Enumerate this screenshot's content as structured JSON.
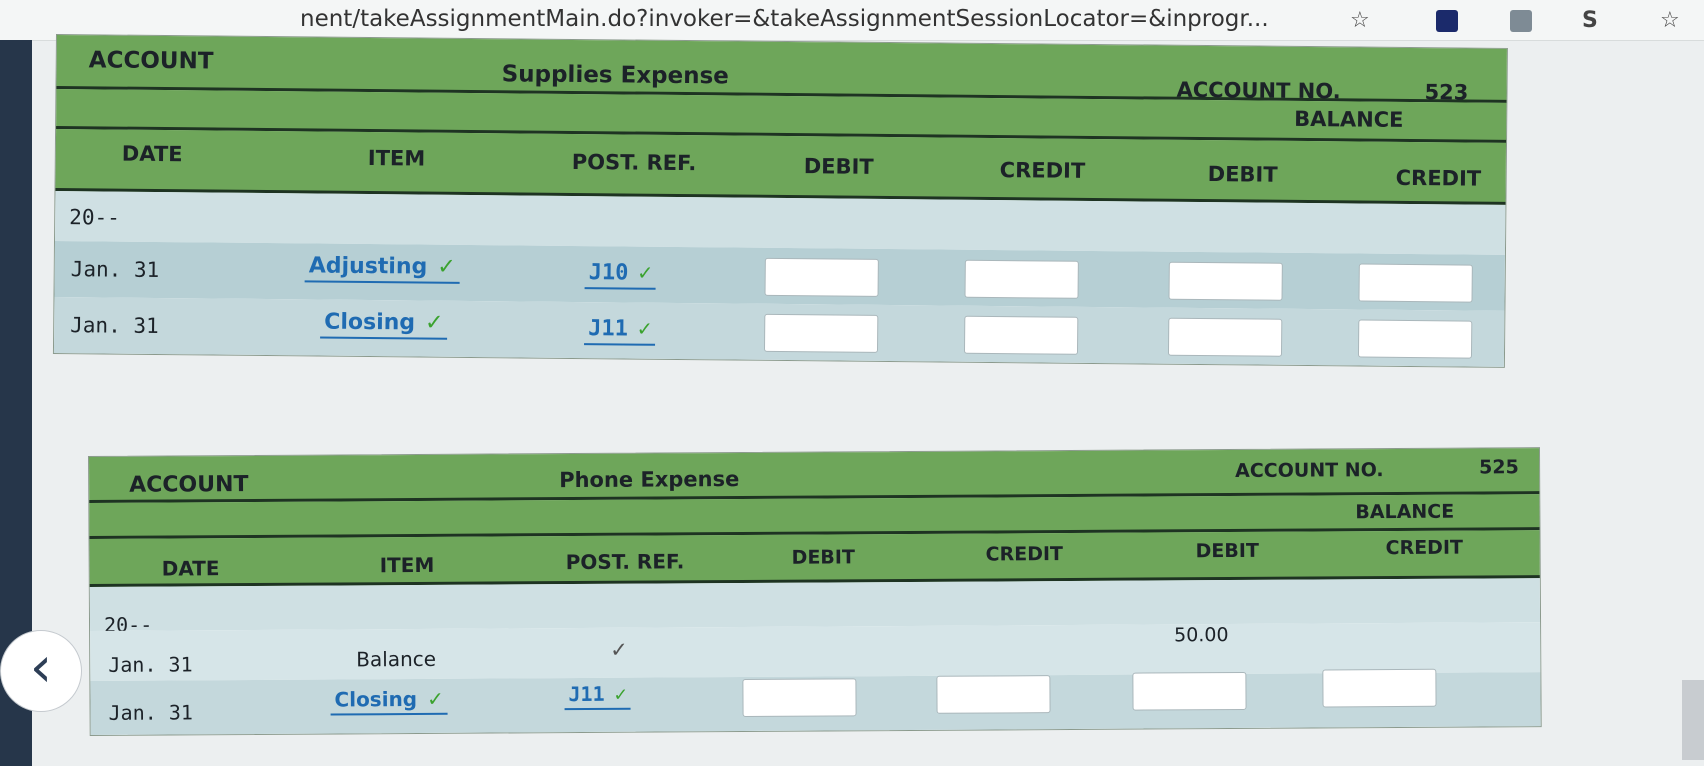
{
  "browser": {
    "url_text": "nent/takeAssignmentMain.do?invoker=&takeAssignmentSessionLocator=&inprogr...",
    "ext_letter": "S"
  },
  "ledgers": [
    {
      "account_label": "ACCOUNT",
      "account_name": "Supplies Expense",
      "account_no_label": "ACCOUNT NO.",
      "account_no": "523",
      "balance_label": "BALANCE",
      "columns": [
        "DATE",
        "ITEM",
        "POST. REF.",
        "DEBIT",
        "CREDIT",
        "DEBIT",
        "CREDIT"
      ],
      "year": "20--",
      "entries": [
        {
          "date": "Jan. 31",
          "item": "Adjusting",
          "post_ref": "J10",
          "balance_debit": ""
        },
        {
          "date": "Jan. 31",
          "item": "Closing",
          "post_ref": "J11",
          "balance_debit": ""
        }
      ]
    },
    {
      "account_label": "ACCOUNT",
      "account_name": "Phone Expense",
      "account_no_label": "ACCOUNT NO.",
      "account_no": "525",
      "balance_label": "BALANCE",
      "columns": [
        "DATE",
        "ITEM",
        "POST. REF.",
        "DEBIT",
        "CREDIT",
        "DEBIT",
        "CREDIT"
      ],
      "year": "20--",
      "entries": [
        {
          "date": "Jan. 31",
          "item": "Balance",
          "post_ref": "✓",
          "balance_debit": "50.00"
        },
        {
          "date": "Jan. 31",
          "item": "Closing",
          "post_ref": "J11",
          "balance_debit": ""
        }
      ]
    }
  ],
  "icons": {
    "check": "✓",
    "back": "‹"
  },
  "colors": {
    "header_green": "#6ea65a",
    "row_blue": "#cfe0e3",
    "link_blue": "#1f6bb2",
    "check_green": "#3aa22e"
  }
}
